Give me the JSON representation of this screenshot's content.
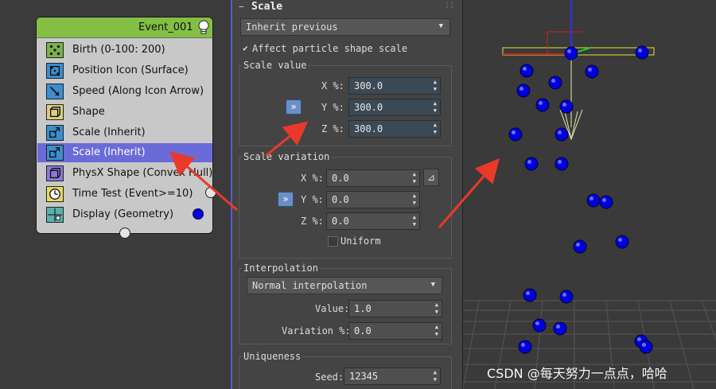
{
  "event": {
    "title": "Event_001",
    "operators": [
      {
        "label": "Birth (0-100: 200)",
        "icon": "birth-icon",
        "selected": false
      },
      {
        "label": "Position Icon (Surface)",
        "icon": "position-icon",
        "selected": false
      },
      {
        "label": "Speed (Along Icon Arrow)",
        "icon": "speed-icon",
        "selected": false
      },
      {
        "label": "Shape",
        "icon": "shape-icon",
        "selected": false
      },
      {
        "label": "Scale (Inherit)",
        "icon": "scale-icon",
        "selected": false
      },
      {
        "label": "Scale (Inherit)",
        "icon": "scale-icon",
        "selected": true
      },
      {
        "label": "PhysX Shape (Convex Hull)",
        "icon": "physx-shape-icon",
        "selected": false
      },
      {
        "label": "Time Test (Event>=10)",
        "icon": "clock-icon",
        "selected": false
      },
      {
        "label": "Display (Geometry)",
        "icon": "display-icon",
        "selected": false
      }
    ]
  },
  "rollout": {
    "title": "Scale",
    "collapse_symbol": "−",
    "type_dropdown": "Inherit previous",
    "affect_shape_label": "Affect particle shape scale",
    "affect_shape_checked": "✔",
    "scale_value": {
      "title": "Scale value",
      "x_label": "X %:",
      "x_value": "300.0",
      "y_label": "Y %:",
      "y_value": "300.0",
      "z_label": "Z %:",
      "z_value": "300.0",
      "lock_button": "»"
    },
    "scale_variation": {
      "title": "Scale variation",
      "x_label": "X %:",
      "x_value": "0.0",
      "y_label": "Y %:",
      "y_value": "0.0",
      "z_label": "Z %:",
      "z_value": "0.0",
      "lock_button": "»",
      "extra_button": "⊿",
      "uniform_label": "Uniform"
    },
    "interpolation": {
      "title": "Interpolation",
      "dropdown": "Normal interpolation",
      "value_label": "Value:",
      "value": "1.0",
      "variation_label": "Variation %:",
      "variation": "0.0"
    },
    "uniqueness": {
      "title": "Uniqueness",
      "seed_label": "Seed:",
      "seed": "12345"
    }
  },
  "viewport": {
    "watermark": "CSDN @每天努力一点点，哈哈",
    "particle_color": "#0000dd",
    "gizmo_color": "#e0e040"
  },
  "colors": {
    "event_header": "#83bf44",
    "selected_row": "#6b6bd8",
    "annotation_arrow": "#e8392a"
  }
}
